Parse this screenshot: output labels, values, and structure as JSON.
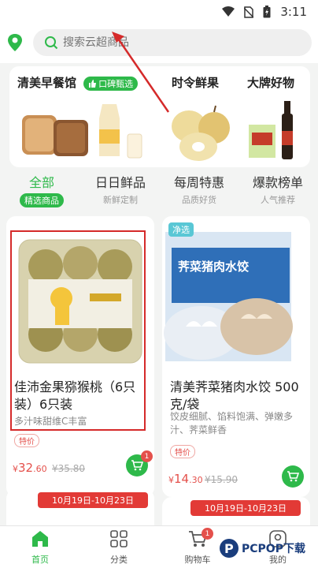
{
  "status": {
    "time": "3:11"
  },
  "search": {
    "placeholder": "搜索云超商品"
  },
  "promo": {
    "breakfast_title": "清美早餐馆",
    "breakfast_tag": "口碑甄选",
    "fresh_title": "时令鲜果",
    "brand_title": "大牌好物"
  },
  "tabs": [
    {
      "title": "全部",
      "sub": "精选商品"
    },
    {
      "title": "日日鲜品",
      "sub": "新鲜定制"
    },
    {
      "title": "每周特惠",
      "sub": "品质好货"
    },
    {
      "title": "爆款榜单",
      "sub": "人气推荐"
    }
  ],
  "products": [
    {
      "title": "佳沛金果猕猴桃（6只装）6只装",
      "sub": "多汁味甜维C丰富",
      "tag": "特价",
      "price_symbol": "¥",
      "price_int": "32",
      "price_dec": ".60",
      "old_price": "¥35.80",
      "cart_count": "1"
    },
    {
      "badge": "净选",
      "package_text": "荠菜猪肉水饺",
      "title": "清美荠菜猪肉水饺 500克/袋",
      "sub": "饺皮细腻、馅料饱满、弹嫩多汁、荠菜鲜香",
      "tag": "特价",
      "price_symbol": "¥",
      "price_int": "14",
      "price_dec": ".30",
      "old_price": "¥15.90"
    }
  ],
  "date_strip": "10月19日-10月23日",
  "date_strip_2": "10月19日-10月23日",
  "nav": {
    "home": "首页",
    "category": "分类",
    "cart": "购物车",
    "cart_count": "1",
    "mine": "我的"
  },
  "watermark": {
    "brand": "PCPOP下载"
  },
  "colors": {
    "accent": "#2eb94a",
    "price": "#e4504b",
    "highlight_box": "#d52a2a"
  }
}
